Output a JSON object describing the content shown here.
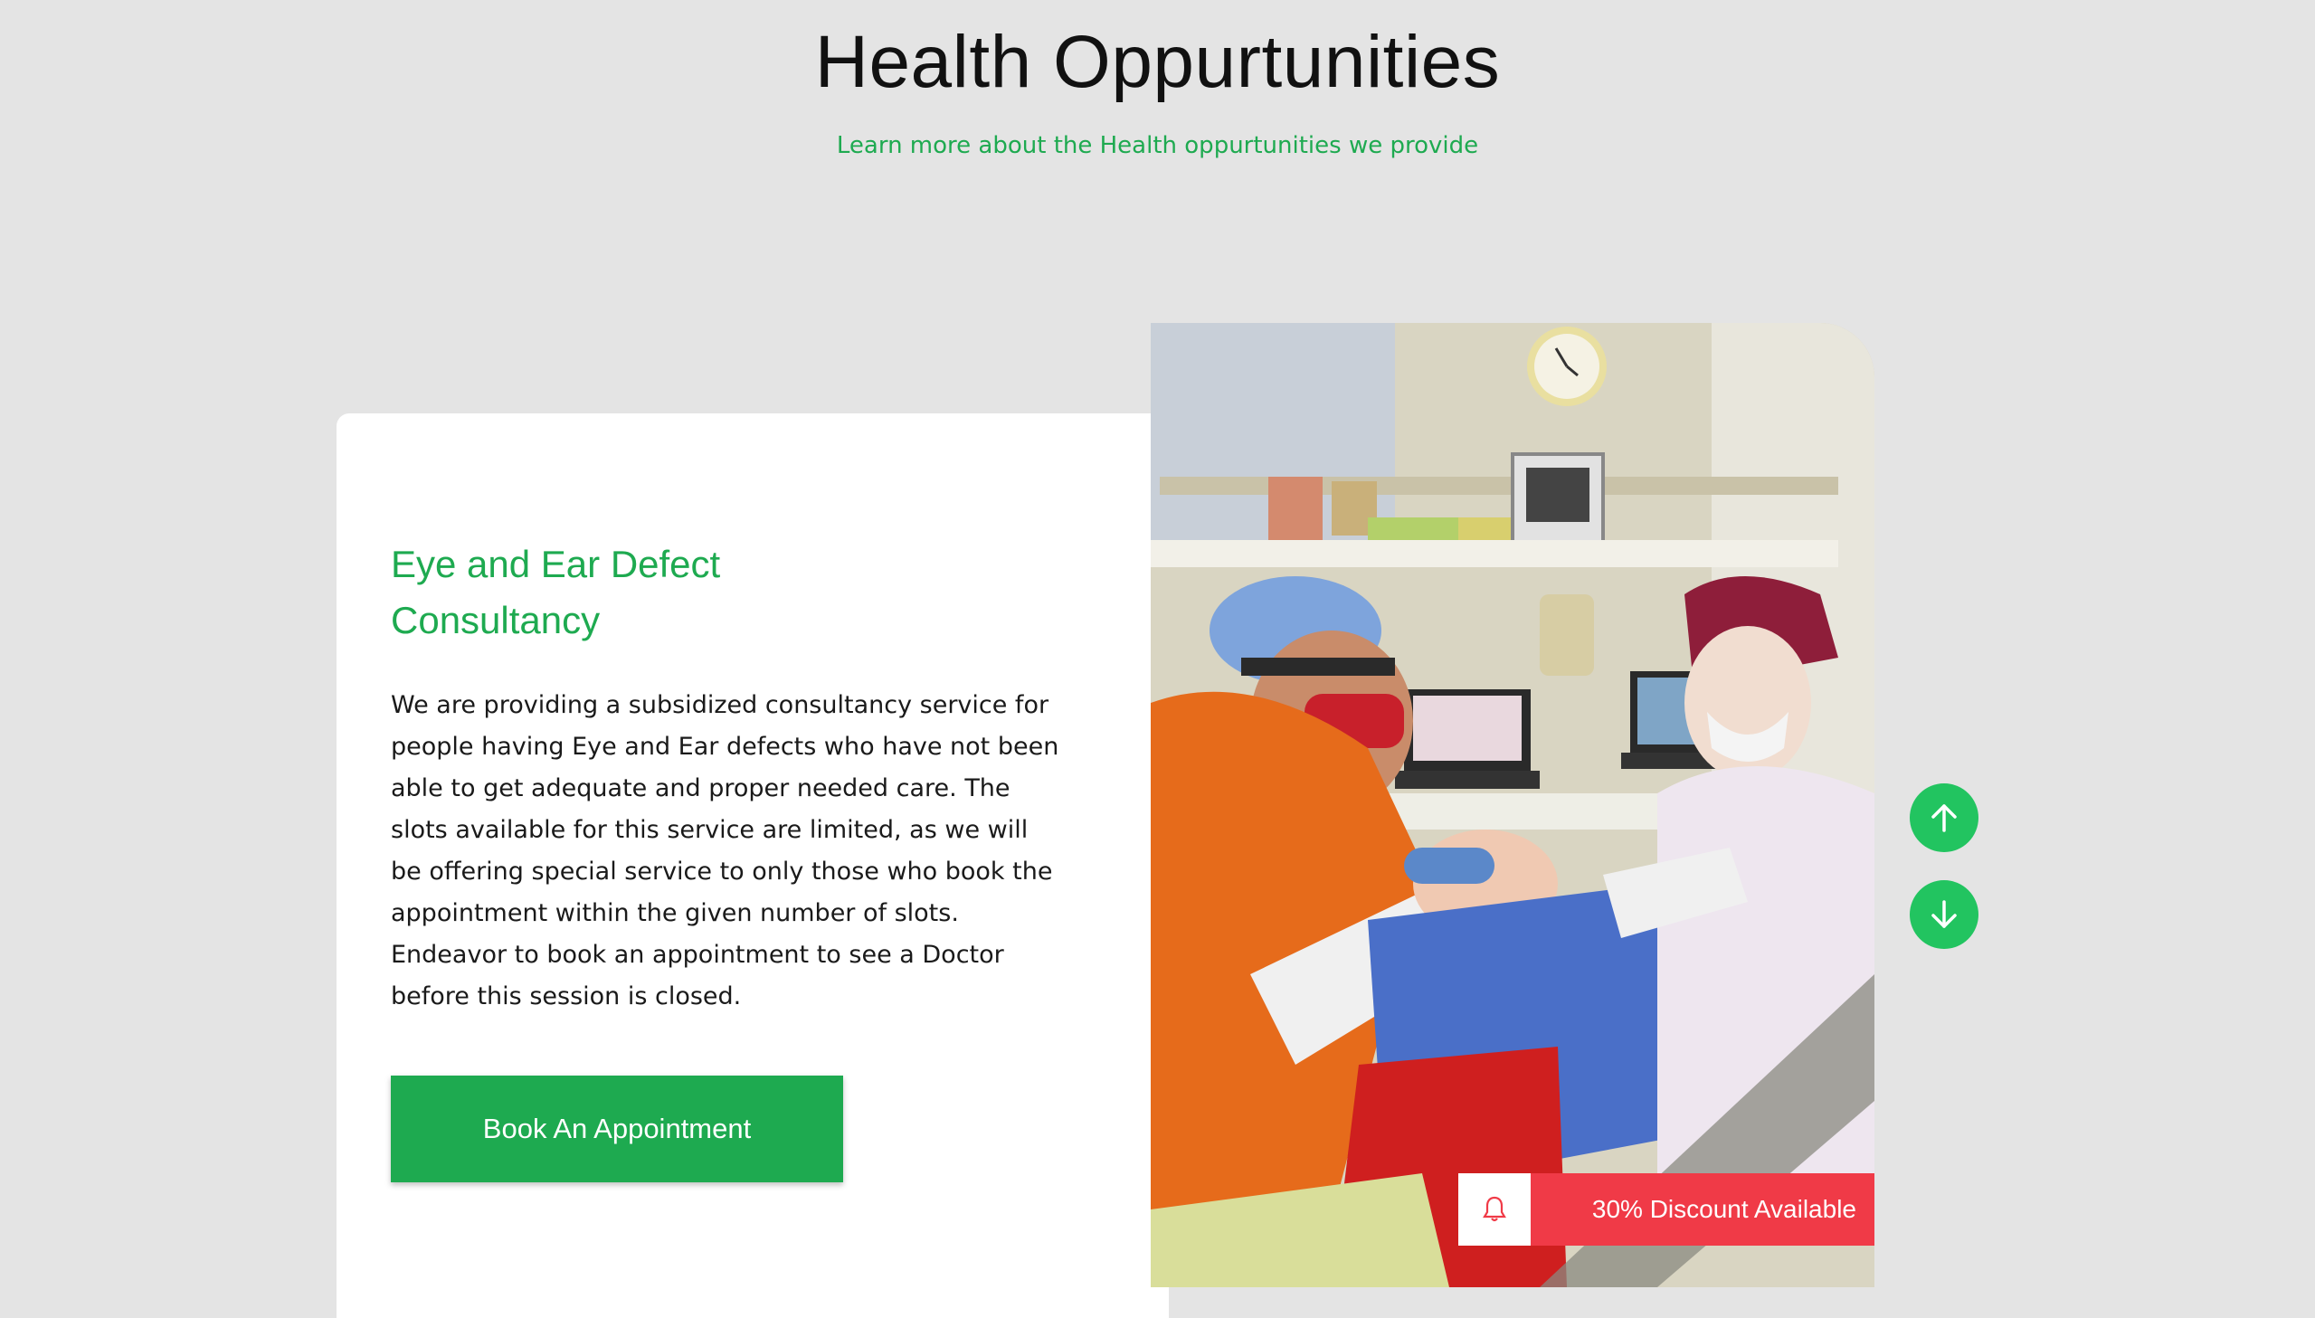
{
  "header": {
    "title": "Health Oppurtunities",
    "subtitle": "Learn more about the Health oppurtunities we provide"
  },
  "card": {
    "title": "Eye and Ear Defect Consultancy",
    "description": "We are providing a subsidized consultancy service for people having Eye and Ear defects who have not been able to get adequate and proper needed care. The slots available for this service are limited, as we will be offering special service to only those who book the appointment within the given number of slots. Endeavor to book an appointment to see a Doctor before this session is closed.",
    "button_label": "Book An Appointment"
  },
  "discount": {
    "label": "30% Discount Available",
    "icon": "bell-icon"
  },
  "navigation": {
    "up_icon": "arrow-up-icon",
    "down_icon": "arrow-down-icon"
  },
  "colors": {
    "accent": "#1eaa50",
    "nav_button": "#22c460",
    "discount": "#f03a47",
    "background": "#e4e4e4"
  }
}
